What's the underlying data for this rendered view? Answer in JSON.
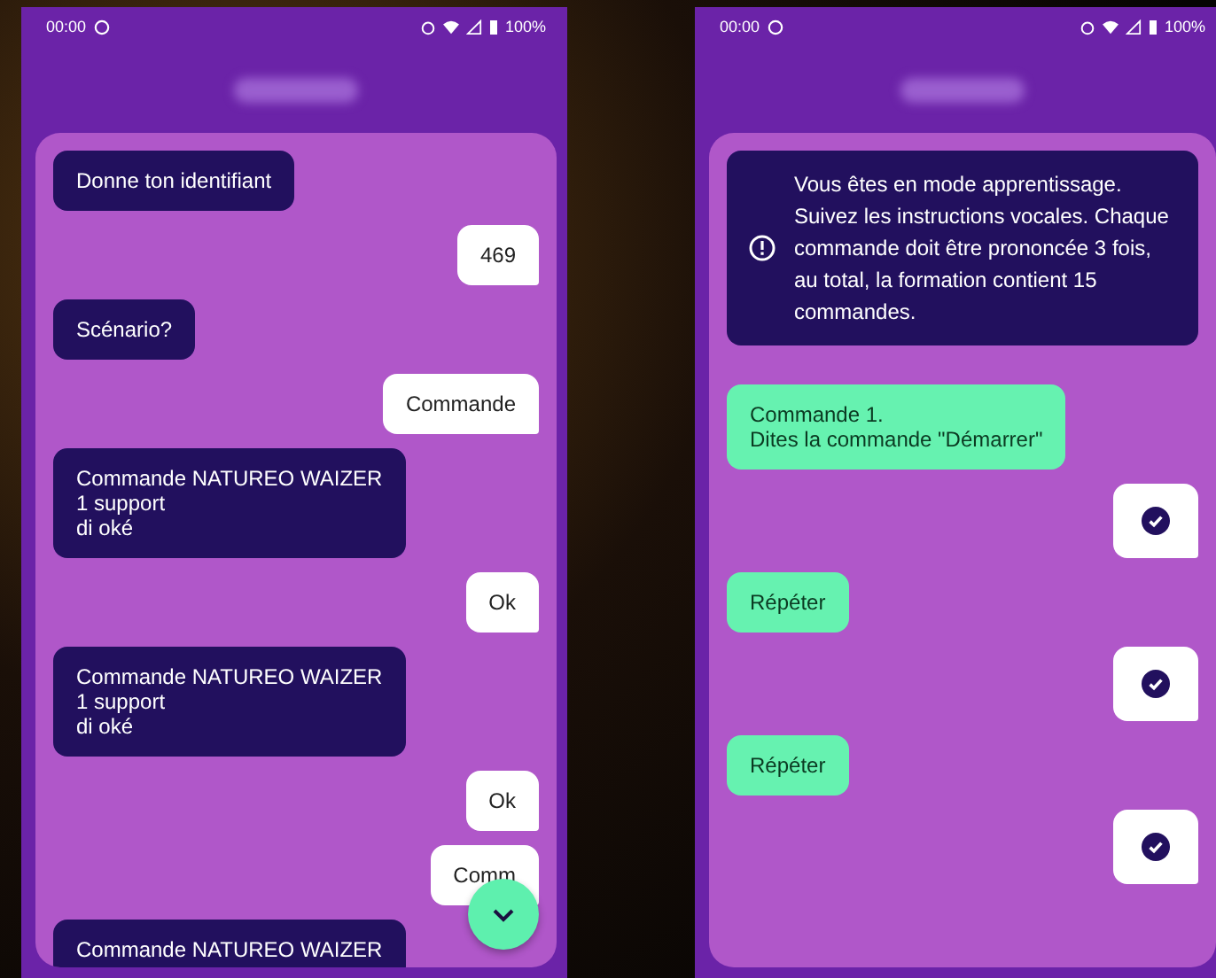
{
  "phones": [
    {
      "status_bar": {
        "time": "00:00",
        "battery": "100%"
      },
      "messages": [
        {
          "kind": "bot",
          "text": "Donne ton identifiant"
        },
        {
          "kind": "user",
          "text": "469"
        },
        {
          "kind": "bot",
          "text": "Scénario?"
        },
        {
          "kind": "user",
          "text": "Commande"
        },
        {
          "kind": "bot",
          "text": "Commande NATUREO WAIZER\n1 support\ndi oké"
        },
        {
          "kind": "user",
          "text": "Ok"
        },
        {
          "kind": "bot",
          "text": "Commande NATUREO WAIZER\n1 support\ndi oké"
        },
        {
          "kind": "user",
          "text": "Ok"
        },
        {
          "kind": "user",
          "text": "Comm"
        },
        {
          "kind": "bot",
          "text": "Commande NATUREO WAIZER"
        }
      ],
      "scroll_down_button": true
    },
    {
      "status_bar": {
        "time": "00:00",
        "battery": "100%"
      },
      "messages": [
        {
          "kind": "notice",
          "text": "Vous êtes en mode apprentissage. Suivez les instructions vocales. Chaque commande doit être prononcée 3 fois, au total, la formation contient 15 commandes."
        },
        {
          "kind": "prompt",
          "text": "Commande 1.\nDites la commande \"Démarrer\""
        },
        {
          "kind": "check"
        },
        {
          "kind": "prompt",
          "text": "Répéter"
        },
        {
          "kind": "check"
        },
        {
          "kind": "prompt",
          "text": "Répéter"
        },
        {
          "kind": "check"
        }
      ],
      "scroll_down_button": false
    }
  ]
}
